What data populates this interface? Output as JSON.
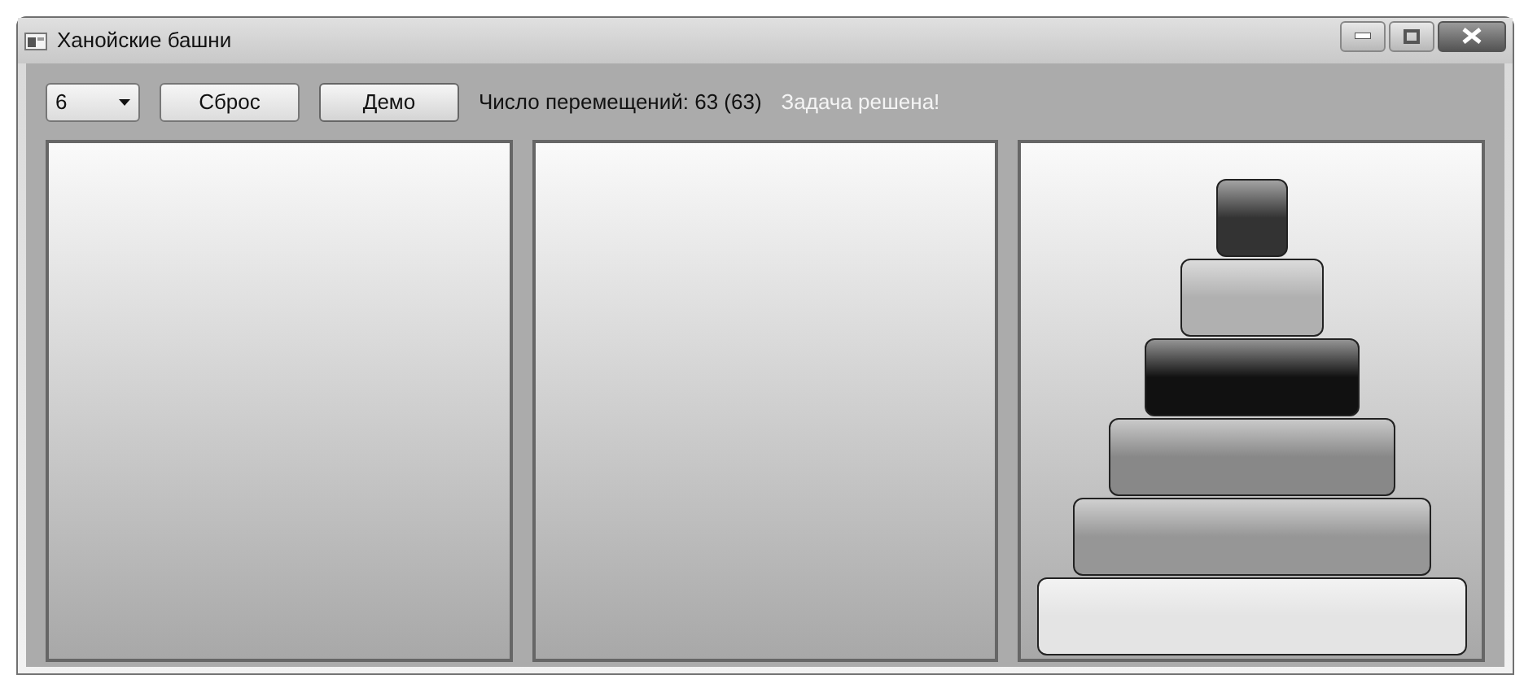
{
  "window": {
    "title": "Ханойские башни"
  },
  "toolbar": {
    "disk_count": "6",
    "reset_button": "Сброс",
    "demo_button": "Демо",
    "moves": "Число перемещений: 63 (63)",
    "status": "Задача решена!"
  },
  "pegs": [
    {
      "kind": "empty"
    },
    {
      "kind": "empty"
    },
    {
      "kind": "stack",
      "disks": [
        {
          "color": "#333333"
        },
        {
          "color": "#b0b0b0"
        },
        {
          "color": "#111111"
        },
        {
          "color": "#888888"
        },
        {
          "color": "#969696"
        },
        {
          "color": "#e4e4e4"
        }
      ]
    }
  ]
}
